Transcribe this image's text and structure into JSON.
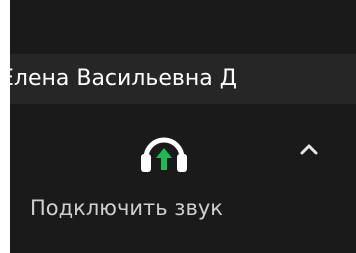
{
  "participant": {
    "name": "Елена Васильевна Д"
  },
  "audio_control": {
    "icon": "headphones-arrow-up-icon",
    "label": "Подключить звук",
    "menu_icon": "chevron-up-icon"
  },
  "colors": {
    "background": "#1a1a1a",
    "name_bar": "#262626",
    "text": "#ffffff",
    "label": "#cfcfcf",
    "icon": "#ffffff",
    "arrow_accent": "#1db954"
  }
}
